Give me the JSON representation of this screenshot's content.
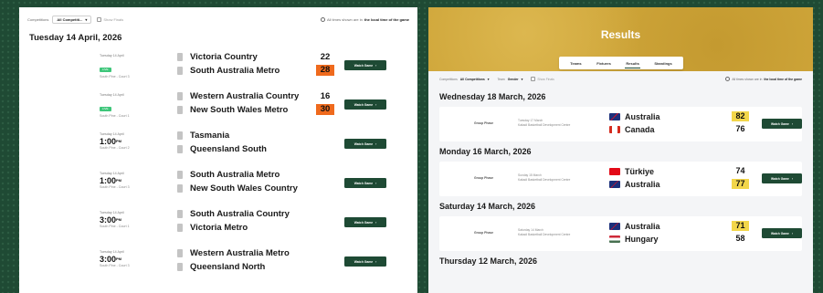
{
  "left": {
    "filter": {
      "competitions_label": "Competitions",
      "competitions_value": "All Competiti...",
      "show_finals_label": "Show Finals",
      "tz_note_prefix": "All times shown are in",
      "tz_note_bold": "the local time of the game"
    },
    "date_heading": "Tuesday 14 April, 2026",
    "games": [
      {
        "date": "Tuesday 14 April",
        "status": "LIVE",
        "time": "",
        "ampm": "",
        "venue": "South Pine - Court 3",
        "home": "Victoria Country",
        "away": "South Australia Metro",
        "home_score": "22",
        "away_score": "28",
        "winner": "away",
        "button": "Watch Game"
      },
      {
        "date": "Tuesday 14 April",
        "status": "LIVE",
        "time": "",
        "ampm": "",
        "venue": "South Pine - Court 1",
        "home": "Western Australia Country",
        "away": "New South Wales Metro",
        "home_score": "16",
        "away_score": "30",
        "winner": "away",
        "button": "Watch Game"
      },
      {
        "date": "Tuesday 14 April",
        "status": "",
        "time": "1:00",
        "ampm": "PM",
        "venue": "South Pine - Court 2",
        "home": "Tasmania",
        "away": "Queensland South",
        "home_score": "",
        "away_score": "",
        "winner": "",
        "button": "Watch Game"
      },
      {
        "date": "Tuesday 14 April",
        "status": "",
        "time": "1:00",
        "ampm": "PM",
        "venue": "South Pine - Court 3",
        "home": "South Australia Metro",
        "away": "New South Wales Country",
        "home_score": "",
        "away_score": "",
        "winner": "",
        "button": "Watch Game"
      },
      {
        "date": "Tuesday 14 April",
        "status": "",
        "time": "3:00",
        "ampm": "PM",
        "venue": "South Pine - Court 1",
        "home": "South Australia Country",
        "away": "Victoria Metro",
        "home_score": "",
        "away_score": "",
        "winner": "",
        "button": "Watch Game"
      },
      {
        "date": "Tuesday 14 April",
        "status": "",
        "time": "3:00",
        "ampm": "PM",
        "venue": "South Pine - Court 3",
        "home": "Western Australia Metro",
        "away": "Queensland North",
        "home_score": "",
        "away_score": "",
        "winner": "",
        "button": "Watch Game"
      }
    ]
  },
  "right": {
    "title": "Results",
    "tabs": [
      "Teams",
      "Fixtures",
      "Results",
      "Standings"
    ],
    "active_tab": "Results",
    "filter": {
      "competitions_label": "Competitions",
      "competitions_value": "All Competitions",
      "team_label": "Team",
      "team_value": "Gender",
      "show_finals_label": "Show Finals",
      "tz_note_prefix": "All times shown are in",
      "tz_note_bold": "the local time of the game"
    },
    "results": [
      {
        "date_heading": "Wednesday 18 March, 2026",
        "stage": "Group Phase",
        "meta_date": "Tuesday 17 March",
        "meta_venue": "Kakadi Basketball Development Centre",
        "home": "Australia",
        "home_flag": "australia",
        "away": "Canada",
        "away_flag": "canada",
        "home_score": "82",
        "away_score": "76",
        "winner": "home",
        "button": "Watch Game"
      },
      {
        "date_heading": "Monday 16 March, 2026",
        "stage": "Group Phase",
        "meta_date": "Sunday 15 March",
        "meta_venue": "Kakadi Basketball Development Centre",
        "home": "Türkiye",
        "home_flag": "turkiye",
        "away": "Australia",
        "away_flag": "australia",
        "home_score": "74",
        "away_score": "77",
        "winner": "away",
        "button": "Watch Game"
      },
      {
        "date_heading": "Saturday 14 March, 2026",
        "stage": "Group Phase",
        "meta_date": "Saturday 14 March",
        "meta_venue": "Kakadi Basketball Development Centre",
        "home": "Australia",
        "home_flag": "australia",
        "away": "Hungary",
        "away_flag": "hungary",
        "home_score": "71",
        "away_score": "58",
        "winner": "home",
        "button": "Watch Game"
      }
    ],
    "next_date_heading": "Thursday 12 March, 2026"
  },
  "colors": {
    "background": "#1f4a34",
    "button": "#1e4a34",
    "live_badge": "#3ec67a",
    "left_winner_highlight": "#ef6a1d",
    "right_winner_highlight": "#f2d64a",
    "header_gold": "#cfa63a"
  }
}
